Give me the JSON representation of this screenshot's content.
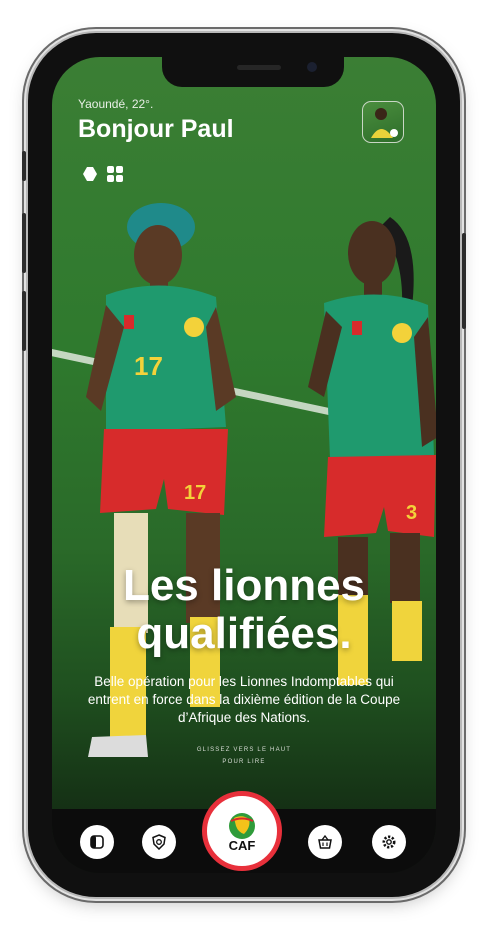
{
  "header": {
    "weather": "Yaoundé, 22°.",
    "greeting": "Bonjour Paul"
  },
  "story": {
    "headline_line1": "Les lionnes",
    "headline_line2": "qualifiées.",
    "summary": "Belle opération pour les Lionnes Indomptables qui entrent en force dans la dixième édition de la Coupe d’Afrique des Nations.",
    "hint_line1": "GLISSEZ VERS LE HAUT",
    "hint_line2": "POUR LIRE"
  },
  "bottom_nav": {
    "center_logo_text": "CAF",
    "items": [
      "panel-icon",
      "shield-icon",
      "caf-logo",
      "basket-icon",
      "gear-icon"
    ]
  },
  "colors": {
    "caf_ring": "#e8303b",
    "jersey": "#1f9a6e",
    "shorts": "#d72b2b"
  }
}
